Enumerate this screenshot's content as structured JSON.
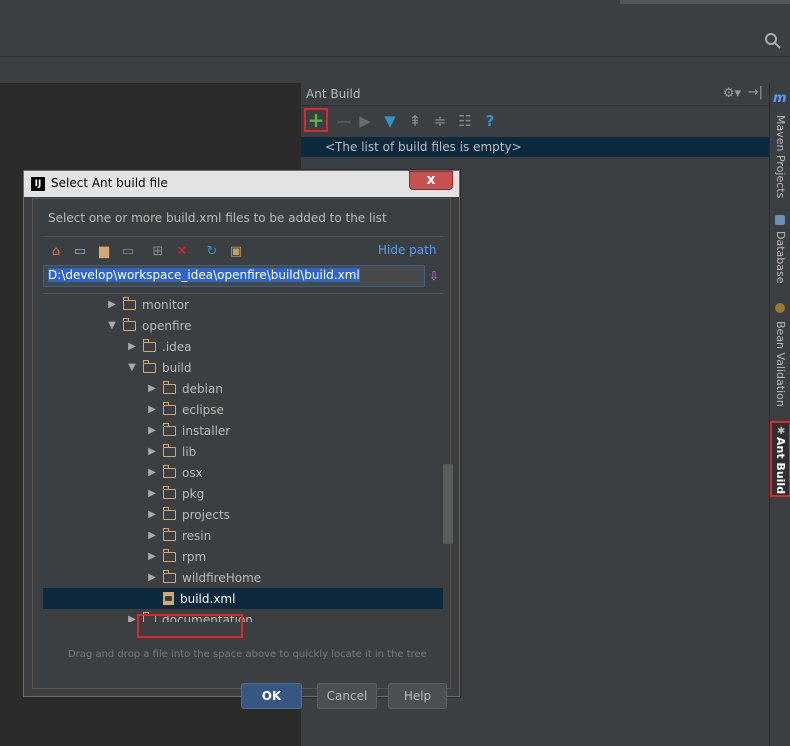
{
  "ant_panel": {
    "title": "Ant Build",
    "empty_message": "<The list of build files is empty>",
    "toolbar_icons": [
      "add-icon",
      "remove-icon",
      "run-icon",
      "filter-icon",
      "expand-all-icon",
      "collapse-all-icon",
      "properties-icon",
      "help-icon"
    ]
  },
  "sidebar": {
    "tabs": [
      {
        "label": "Maven Projects",
        "icon": "m"
      },
      {
        "label": "Database",
        "icon": ""
      },
      {
        "label": "Bean Validation",
        "icon": ""
      },
      {
        "label": "Ant Build",
        "icon": ""
      }
    ]
  },
  "dialog": {
    "title": "Select Ant build file",
    "description": "Select one or more build.xml files to be added to the list",
    "hide_path": "Hide path",
    "path_value": "D:\\develop\\workspace_idea\\openfire\\build\\build.xml",
    "drag_hint": "Drag and drop a file into the space above to quickly locate it in the tree",
    "ok": "OK",
    "cancel": "Cancel",
    "help": "Help",
    "close": "x",
    "tree": [
      {
        "label": "monitor",
        "expanded": false,
        "kind": "folder"
      },
      {
        "label": "openfire",
        "expanded": true,
        "kind": "folder"
      },
      {
        "label": ".idea",
        "expanded": false,
        "kind": "folder"
      },
      {
        "label": "build",
        "expanded": true,
        "kind": "folder"
      },
      {
        "label": "debian",
        "expanded": false,
        "kind": "folder"
      },
      {
        "label": "eclipse",
        "expanded": false,
        "kind": "folder"
      },
      {
        "label": "installer",
        "expanded": false,
        "kind": "folder"
      },
      {
        "label": "lib",
        "expanded": false,
        "kind": "folder"
      },
      {
        "label": "osx",
        "expanded": false,
        "kind": "folder"
      },
      {
        "label": "pkg",
        "expanded": false,
        "kind": "folder"
      },
      {
        "label": "projects",
        "expanded": false,
        "kind": "folder"
      },
      {
        "label": "resin",
        "expanded": false,
        "kind": "folder"
      },
      {
        "label": "rpm",
        "expanded": false,
        "kind": "folder"
      },
      {
        "label": "wildfireHome",
        "expanded": false,
        "kind": "folder"
      },
      {
        "label": "build.xml",
        "expanded": false,
        "kind": "xml",
        "selected": true
      },
      {
        "label": "documentation",
        "expanded": false,
        "kind": "folder"
      }
    ]
  },
  "colors": {
    "accent_red": "#e0262b",
    "selection": "#0d293e",
    "link": "#589df6"
  }
}
